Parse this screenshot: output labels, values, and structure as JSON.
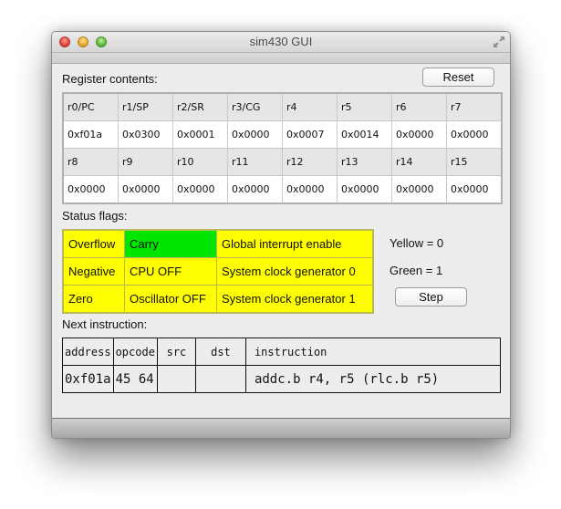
{
  "window": {
    "title": "sim430 GUI"
  },
  "registers": {
    "section_label": "Register contents:",
    "reset_label": "Reset",
    "rows": [
      {
        "names": [
          "r0/PC",
          "r1/SP",
          "r2/SR",
          "r3/CG",
          "r4",
          "r5",
          "r6",
          "r7"
        ],
        "values": [
          "0xf01a",
          "0x0300",
          "0x0001",
          "0x0000",
          "0x0007",
          "0x0014",
          "0x0000",
          "0x0000"
        ]
      },
      {
        "names": [
          "r8",
          "r9",
          "r10",
          "r11",
          "r12",
          "r13",
          "r14",
          "r15"
        ],
        "values": [
          "0x0000",
          "0x0000",
          "0x0000",
          "0x0000",
          "0x0000",
          "0x0000",
          "0x0000",
          "0x0000"
        ]
      }
    ]
  },
  "flags": {
    "section_label": "Status flags:",
    "colors": {
      "off": "#ffff00",
      "on": "#00e600"
    },
    "rows": [
      [
        {
          "label": "Overflow",
          "value": 0
        },
        {
          "label": "Carry",
          "value": 1
        },
        {
          "label": "Global interrupt enable",
          "value": 0
        }
      ],
      [
        {
          "label": "Negative",
          "value": 0
        },
        {
          "label": "CPU OFF",
          "value": 0
        },
        {
          "label": "System clock generator 0",
          "value": 0
        }
      ],
      [
        {
          "label": "Zero",
          "value": 0
        },
        {
          "label": "Oscillator OFF",
          "value": 0
        },
        {
          "label": "System clock generator 1",
          "value": 0
        }
      ]
    ],
    "legend_yellow": "Yellow = 0",
    "legend_green": "Green = 1",
    "step_label": "Step"
  },
  "next_instruction": {
    "section_label": "Next instruction:",
    "headers": [
      "address",
      "opcode",
      "src",
      "dst",
      "instruction"
    ],
    "row": [
      "0xf01a",
      "45 64",
      "",
      "",
      "addc.b r4, r5 (rlc.b r5)"
    ]
  }
}
